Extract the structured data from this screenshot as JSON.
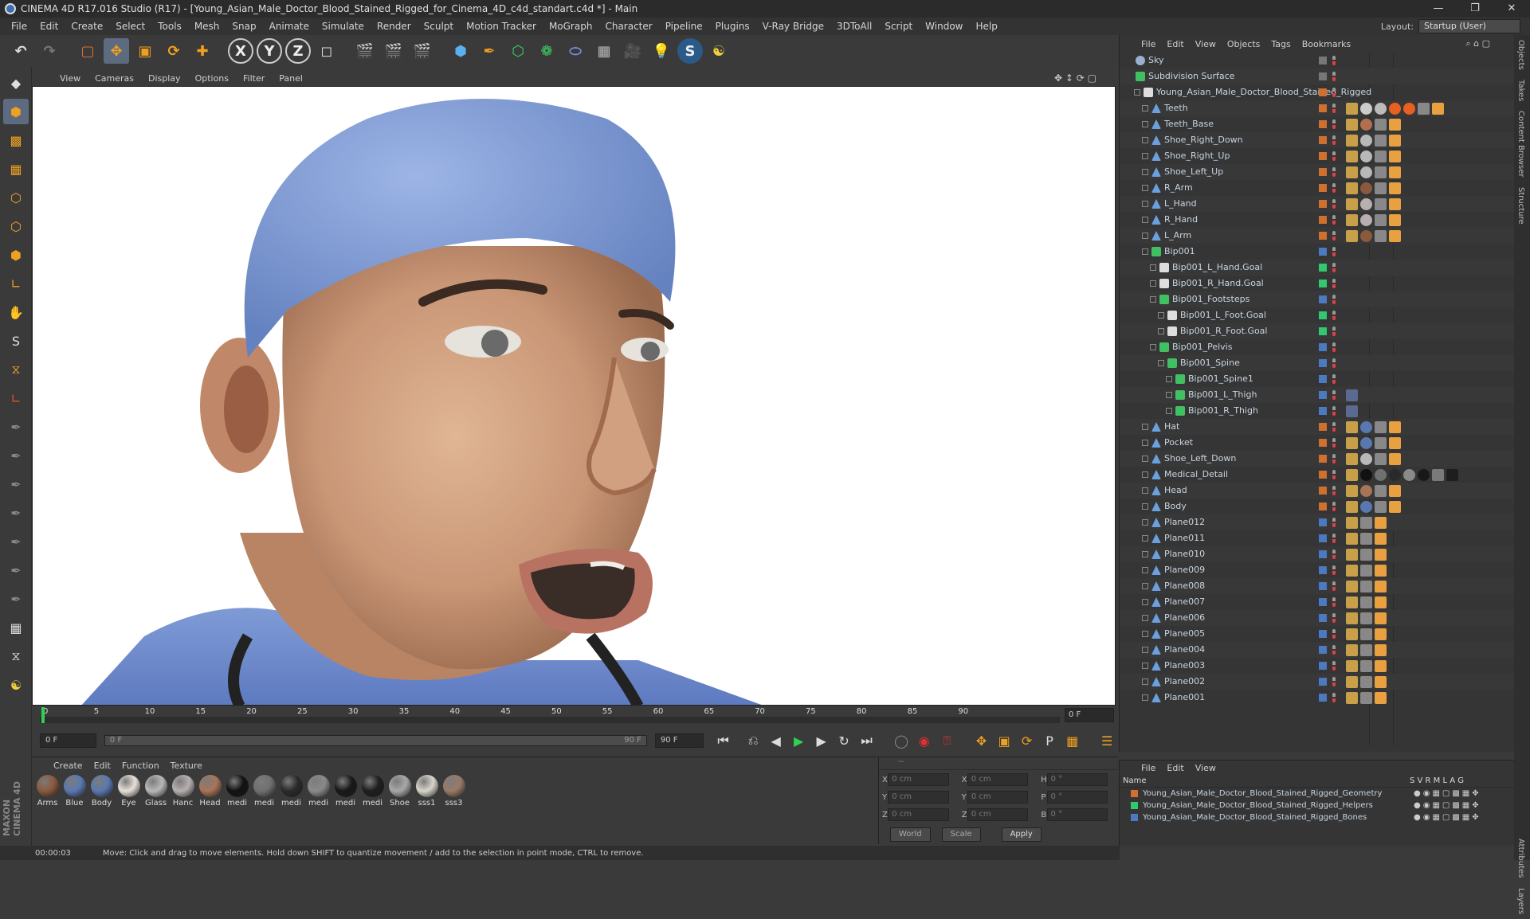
{
  "window": {
    "title": "CINEMA 4D R17.016 Studio (R17) - [Young_Asian_Male_Doctor_Blood_Stained_Rigged_for_Cinema_4D_c4d_standart.c4d *] - Main"
  },
  "menubar": {
    "items": [
      "File",
      "Edit",
      "Create",
      "Select",
      "Tools",
      "Mesh",
      "Snap",
      "Animate",
      "Simulate",
      "Render",
      "Sculpt",
      "Motion Tracker",
      "MoGraph",
      "Character",
      "Pipeline",
      "Plugins",
      "V-Ray Bridge",
      "3DToAll",
      "Script",
      "Window",
      "Help"
    ],
    "layout_label": "Layout:",
    "layout_value": "Startup (User)"
  },
  "viewport": {
    "menu": [
      "View",
      "Cameras",
      "Display",
      "Options",
      "Filter",
      "Panel"
    ]
  },
  "timeline": {
    "ticks": [
      "0",
      "5",
      "10",
      "15",
      "20",
      "25",
      "30",
      "35",
      "40",
      "45",
      "50",
      "55",
      "60",
      "65",
      "70",
      "75",
      "80",
      "85",
      "90"
    ],
    "current_frame": "0 F"
  },
  "transport": {
    "start": "0 F",
    "range_start": "0 F",
    "range_end": "90 F",
    "end": "90 F"
  },
  "materials": {
    "menu": [
      "Create",
      "Edit",
      "Function",
      "Texture"
    ],
    "items": [
      {
        "label": "Arms",
        "color": "#8a5a3e"
      },
      {
        "label": "Blue",
        "color": "#5a78b0"
      },
      {
        "label": "Body",
        "color": "#5a78b0"
      },
      {
        "label": "Eye",
        "color": "#e8e0d8"
      },
      {
        "label": "Glass",
        "color": "#b8b8b8"
      },
      {
        "label": "Hanc",
        "color": "#b8b0b0"
      },
      {
        "label": "Head",
        "color": "#a87458"
      },
      {
        "label": "medi",
        "color": "#111111"
      },
      {
        "label": "medi",
        "color": "#707070"
      },
      {
        "label": "medi",
        "color": "#2a2a2a"
      },
      {
        "label": "medi",
        "color": "#8a8a8a"
      },
      {
        "label": "medi",
        "color": "#181818"
      },
      {
        "label": "medi",
        "color": "#1e1e1e"
      },
      {
        "label": "Shoe",
        "color": "#a8a8a8"
      },
      {
        "label": "sss1",
        "color": "#d8d4cc"
      },
      {
        "label": "sss3",
        "color": "#9a7a66"
      }
    ]
  },
  "coords": {
    "rows": [
      {
        "a": "X",
        "av": "0 cm",
        "b": "X",
        "bv": "0 cm",
        "c": "H",
        "cv": "0 °"
      },
      {
        "a": "Y",
        "av": "0 cm",
        "b": "Y",
        "bv": "0 cm",
        "c": "P",
        "cv": "0 °"
      },
      {
        "a": "Z",
        "av": "0 cm",
        "b": "Z",
        "bv": "0 cm",
        "c": "B",
        "cv": "0 °"
      }
    ],
    "world": "World",
    "scale": "Scale",
    "apply": "Apply"
  },
  "status": {
    "time": "00:00:03",
    "message": "Move: Click and drag to move elements. Hold down SHIFT to quantize movement / add to the selection in point mode, CTRL to remove."
  },
  "objects_panel": {
    "menu": [
      "File",
      "Edit",
      "View",
      "Objects",
      "Tags",
      "Bookmarks"
    ],
    "items": [
      {
        "name": "Sky",
        "indent": 0,
        "type": "sky",
        "layer": "",
        "tags": []
      },
      {
        "name": "Subdivision Surface",
        "indent": 0,
        "type": "subdiv",
        "layer": "",
        "tags": []
      },
      {
        "name": "Young_Asian_Male_Doctor_Blood_Stained_Rigged",
        "indent": 1,
        "type": "null",
        "layer": "#d0702e",
        "tags": []
      },
      {
        "name": "Teeth",
        "indent": 2,
        "type": "mesh",
        "layer": "#d0702e",
        "tags": [
          "#c8a04a",
          "#cccccc",
          "#bbbbbb",
          "#e86020",
          "#e86020",
          "#888888",
          "#e8a040"
        ]
      },
      {
        "name": "Teeth_Base",
        "indent": 2,
        "type": "mesh",
        "layer": "#d0702e",
        "tags": [
          "#c8a04a",
          "#b07050",
          "#888888",
          "#e8a040"
        ]
      },
      {
        "name": "Shoe_Right_Down",
        "indent": 2,
        "type": "mesh",
        "layer": "#d0702e",
        "tags": [
          "#c8a04a",
          "#b8b8b8",
          "#888888",
          "#e8a040"
        ]
      },
      {
        "name": "Shoe_Right_Up",
        "indent": 2,
        "type": "mesh",
        "layer": "#d0702e",
        "tags": [
          "#c8a04a",
          "#b8b8b8",
          "#888888",
          "#e8a040"
        ]
      },
      {
        "name": "Shoe_Left_Up",
        "indent": 2,
        "type": "mesh",
        "layer": "#d0702e",
        "tags": [
          "#c8a04a",
          "#b8b8b8",
          "#888888",
          "#e8a040"
        ]
      },
      {
        "name": "R_Arm",
        "indent": 2,
        "type": "mesh",
        "layer": "#d0702e",
        "tags": [
          "#c8a04a",
          "#8a5a3e",
          "#888888",
          "#e8a040"
        ]
      },
      {
        "name": "L_Hand",
        "indent": 2,
        "type": "mesh",
        "layer": "#d0702e",
        "tags": [
          "#c8a04a",
          "#b8b0b0",
          "#888888",
          "#e8a040"
        ]
      },
      {
        "name": "R_Hand",
        "indent": 2,
        "type": "mesh",
        "layer": "#d0702e",
        "tags": [
          "#c8a04a",
          "#b8b0b0",
          "#888888",
          "#e8a040"
        ]
      },
      {
        "name": "L_Arm",
        "indent": 2,
        "type": "mesh",
        "layer": "#d0702e",
        "tags": [
          "#c8a04a",
          "#8a5a3e",
          "#888888",
          "#e8a040"
        ]
      },
      {
        "name": "Bip001",
        "indent": 2,
        "type": "bone",
        "layer": "#4a7ac0",
        "tags": []
      },
      {
        "name": "Bip001_L_Hand.Goal",
        "indent": 3,
        "type": "null",
        "layer": "#30c870",
        "tags": []
      },
      {
        "name": "Bip001_R_Hand.Goal",
        "indent": 3,
        "type": "null",
        "layer": "#30c870",
        "tags": []
      },
      {
        "name": "Bip001_Footsteps",
        "indent": 3,
        "type": "bone",
        "layer": "#4a7ac0",
        "tags": []
      },
      {
        "name": "Bip001_L_Foot.Goal",
        "indent": 4,
        "type": "null",
        "layer": "#30c870",
        "tags": []
      },
      {
        "name": "Bip001_R_Foot.Goal",
        "indent": 4,
        "type": "null",
        "layer": "#30c870",
        "tags": []
      },
      {
        "name": "Bip001_Pelvis",
        "indent": 3,
        "type": "bone",
        "layer": "#4a7ac0",
        "tags": []
      },
      {
        "name": "Bip001_Spine",
        "indent": 4,
        "type": "bone",
        "layer": "#4a7ac0",
        "tags": []
      },
      {
        "name": "Bip001_Spine1",
        "indent": 5,
        "type": "bone",
        "layer": "#4a7ac0",
        "tags": []
      },
      {
        "name": "Bip001_L_Thigh",
        "indent": 5,
        "type": "bone",
        "layer": "#4a7ac0",
        "tags": [
          "#5a6a90"
        ]
      },
      {
        "name": "Bip001_R_Thigh",
        "indent": 5,
        "type": "bone",
        "layer": "#4a7ac0",
        "tags": [
          "#5a6a90"
        ]
      },
      {
        "name": "Hat",
        "indent": 2,
        "type": "mesh",
        "layer": "#d0702e",
        "tags": [
          "#c8a04a",
          "#5a78b0",
          "#888888",
          "#e8a040"
        ]
      },
      {
        "name": "Pocket",
        "indent": 2,
        "type": "mesh",
        "layer": "#d0702e",
        "tags": [
          "#c8a04a",
          "#5a78b0",
          "#888888",
          "#e8a040"
        ]
      },
      {
        "name": "Shoe_Left_Down",
        "indent": 2,
        "type": "mesh",
        "layer": "#d0702e",
        "tags": [
          "#c8a04a",
          "#b8b8b8",
          "#888888",
          "#e8a040"
        ]
      },
      {
        "name": "Medical_Detail",
        "indent": 2,
        "type": "mesh",
        "layer": "#d0702e",
        "tags": [
          "#c8a04a",
          "#111111",
          "#707070",
          "#2a2a2a",
          "#8a8a8a",
          "#181818",
          "#7a7a7a",
          "#1e1e1e"
        ]
      },
      {
        "name": "Head",
        "indent": 2,
        "type": "mesh",
        "layer": "#d0702e",
        "tags": [
          "#c8a04a",
          "#a87458",
          "#888888",
          "#e8a040"
        ]
      },
      {
        "name": "Body",
        "indent": 2,
        "type": "mesh",
        "layer": "#d0702e",
        "tags": [
          "#c8a04a",
          "#5a78b0",
          "#888888",
          "#e8a040"
        ]
      },
      {
        "name": "Plane012",
        "indent": 2,
        "type": "mesh",
        "layer": "#4a7ac0",
        "tags": [
          "#c8a04a",
          "#888888",
          "#e8a040"
        ]
      },
      {
        "name": "Plane011",
        "indent": 2,
        "type": "mesh",
        "layer": "#4a7ac0",
        "tags": [
          "#c8a04a",
          "#888888",
          "#e8a040"
        ]
      },
      {
        "name": "Plane010",
        "indent": 2,
        "type": "mesh",
        "layer": "#4a7ac0",
        "tags": [
          "#c8a04a",
          "#888888",
          "#e8a040"
        ]
      },
      {
        "name": "Plane009",
        "indent": 2,
        "type": "mesh",
        "layer": "#4a7ac0",
        "tags": [
          "#c8a04a",
          "#888888",
          "#e8a040"
        ]
      },
      {
        "name": "Plane008",
        "indent": 2,
        "type": "mesh",
        "layer": "#4a7ac0",
        "tags": [
          "#c8a04a",
          "#888888",
          "#e8a040"
        ]
      },
      {
        "name": "Plane007",
        "indent": 2,
        "type": "mesh",
        "layer": "#4a7ac0",
        "tags": [
          "#c8a04a",
          "#888888",
          "#e8a040"
        ]
      },
      {
        "name": "Plane006",
        "indent": 2,
        "type": "mesh",
        "layer": "#4a7ac0",
        "tags": [
          "#c8a04a",
          "#888888",
          "#e8a040"
        ]
      },
      {
        "name": "Plane005",
        "indent": 2,
        "type": "mesh",
        "layer": "#4a7ac0",
        "tags": [
          "#c8a04a",
          "#888888",
          "#e8a040"
        ]
      },
      {
        "name": "Plane004",
        "indent": 2,
        "type": "mesh",
        "layer": "#4a7ac0",
        "tags": [
          "#c8a04a",
          "#888888",
          "#e8a040"
        ]
      },
      {
        "name": "Plane003",
        "indent": 2,
        "type": "mesh",
        "layer": "#4a7ac0",
        "tags": [
          "#c8a04a",
          "#888888",
          "#e8a040"
        ]
      },
      {
        "name": "Plane002",
        "indent": 2,
        "type": "mesh",
        "layer": "#4a7ac0",
        "tags": [
          "#c8a04a",
          "#888888",
          "#e8a040"
        ]
      },
      {
        "name": "Plane001",
        "indent": 2,
        "type": "mesh",
        "layer": "#4a7ac0",
        "tags": [
          "#c8a04a",
          "#888888",
          "#e8a040"
        ]
      }
    ]
  },
  "layers_panel": {
    "menu": [
      "File",
      "Edit",
      "View"
    ],
    "header_name": "Name",
    "header_cols": "S V R M L A G",
    "layers": [
      {
        "name": "Young_Asian_Male_Doctor_Blood_Stained_Rigged_Geometry",
        "color": "#d0702e"
      },
      {
        "name": "Young_Asian_Male_Doctor_Blood_Stained_Rigged_Helpers",
        "color": "#30c870"
      },
      {
        "name": "Young_Asian_Male_Doctor_Blood_Stained_Rigged_Bones",
        "color": "#4a7ac0"
      }
    ]
  },
  "right_tabs": [
    "Objects",
    "Takes",
    "Content Browser",
    "Structure",
    "Attributes",
    "Layers"
  ]
}
